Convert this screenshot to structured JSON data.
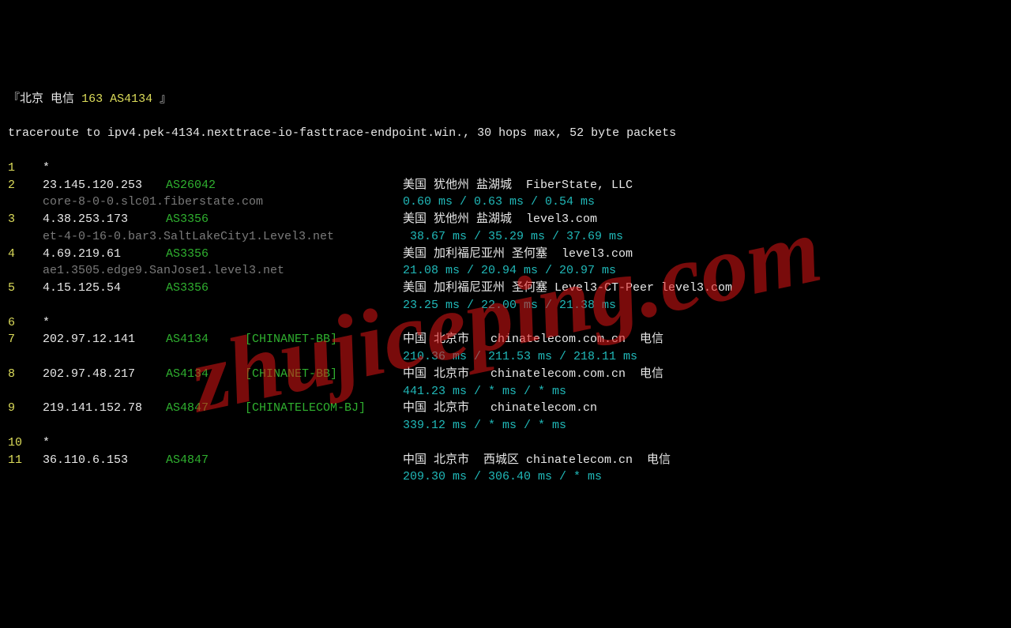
{
  "header": {
    "prefix": "『",
    "label1": "北京",
    "label2": "电信",
    "as_label": "163 AS4134",
    "suffix": " 』"
  },
  "trace_cmd": "traceroute to ipv4.pek-4134.nexttrace-io-fasttrace-endpoint.win., 30 hops max, 52 byte packets",
  "watermark": "zhujiceping.com",
  "hops": [
    {
      "n": "1",
      "ip": "*",
      "asn": "",
      "tag": "",
      "host": "",
      "info": "",
      "lat": ""
    },
    {
      "n": "2",
      "ip": "23.145.120.253",
      "asn": "AS26042",
      "tag": "",
      "host": "core-8-0-0.slc01.fiberstate.com",
      "info": "美国 犹他州 盐湖城  FiberState, LLC",
      "lat": "0.60 ms / 0.63 ms / 0.54 ms"
    },
    {
      "n": "3",
      "ip": "4.38.253.173",
      "asn": "AS3356",
      "tag": "",
      "host": "et-4-0-16-0.bar3.SaltLakeCity1.Level3.net",
      "info": "美国 犹他州 盐湖城  level3.com",
      "lat": " 38.67 ms / 35.29 ms / 37.69 ms"
    },
    {
      "n": "4",
      "ip": "4.69.219.61",
      "asn": "AS3356",
      "tag": "",
      "host": "ae1.3505.edge9.SanJose1.level3.net",
      "info": "美国 加利福尼亚州 圣何塞  level3.com",
      "lat": "21.08 ms / 20.94 ms / 20.97 ms"
    },
    {
      "n": "5",
      "ip": "4.15.125.54",
      "asn": "AS3356",
      "tag": "",
      "host": "",
      "info": "美国 加利福尼亚州 圣何塞 Level3-CT-Peer level3.com",
      "lat": "23.25 ms / 22.00 ms / 21.38 ms"
    },
    {
      "n": "6",
      "ip": "*",
      "asn": "",
      "tag": "",
      "host": "",
      "info": "",
      "lat": ""
    },
    {
      "n": "7",
      "ip": "202.97.12.141",
      "asn": "AS4134",
      "tag": "[CHINANET-BB]",
      "host": "",
      "info": "中国 北京市   chinatelecom.com.cn  电信",
      "lat": "210.36 ms / 211.53 ms / 218.11 ms"
    },
    {
      "n": "8",
      "ip": "202.97.48.217",
      "asn": "AS4134",
      "tag": "[CHINANET-BB]",
      "host": "",
      "info": "中国 北京市   chinatelecom.com.cn  电信",
      "lat": "441.23 ms / * ms / * ms"
    },
    {
      "n": "9",
      "ip": "219.141.152.78",
      "asn": "AS4847",
      "tag": "[CHINATELECOM-BJ]",
      "host": "",
      "info": "中国 北京市   chinatelecom.cn",
      "lat": "339.12 ms / * ms / * ms"
    },
    {
      "n": "10",
      "ip": "*",
      "asn": "",
      "tag": "",
      "host": "",
      "info": "",
      "lat": ""
    },
    {
      "n": "11",
      "ip": "36.110.6.153",
      "asn": "AS4847",
      "tag": "",
      "host": "",
      "info": "中国 北京市  西城区 chinatelecom.cn  电信",
      "lat": "209.30 ms / 306.40 ms / * ms"
    }
  ]
}
